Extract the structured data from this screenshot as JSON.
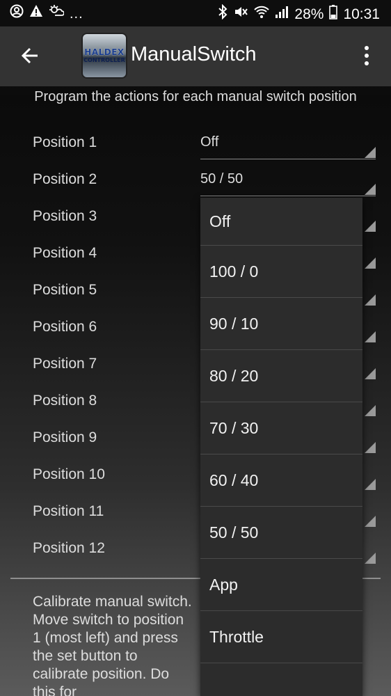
{
  "status_bar": {
    "left_icons": [
      "account-circle-icon",
      "warning-icon",
      "weather-icon"
    ],
    "more": "...",
    "right_icons": [
      "bluetooth-icon",
      "mute-icon",
      "wifi-icon",
      "signal-icon"
    ],
    "battery_percent": "28%",
    "time": "10:31"
  },
  "app_bar": {
    "logo_line1": "HALDEX",
    "logo_line2": "CONTROLLER",
    "title": "ManualSwitch"
  },
  "description": "Program the actions for each manual switch position",
  "positions": [
    {
      "label": "Position 1",
      "value": "Off"
    },
    {
      "label": "Position 2",
      "value": "50 / 50"
    },
    {
      "label": "Position 3",
      "value": ""
    },
    {
      "label": "Position 4",
      "value": ""
    },
    {
      "label": "Position 5",
      "value": ""
    },
    {
      "label": "Position 6",
      "value": ""
    },
    {
      "label": "Position 7",
      "value": ""
    },
    {
      "label": "Position 8",
      "value": ""
    },
    {
      "label": "Position 9",
      "value": ""
    },
    {
      "label": "Position 10",
      "value": ""
    },
    {
      "label": "Position 11",
      "value": ""
    },
    {
      "label": "Position 12",
      "value": ""
    }
  ],
  "calibration_text": "Calibrate manual switch. Move switch to position 1 (most left) and press the set button to calibrate position. Do this for",
  "dropdown_options": [
    "Off",
    "100 / 0",
    "90 / 10",
    "80 / 20",
    "70 / 30",
    "60 / 40",
    "50 / 50",
    "App",
    "Throttle"
  ]
}
